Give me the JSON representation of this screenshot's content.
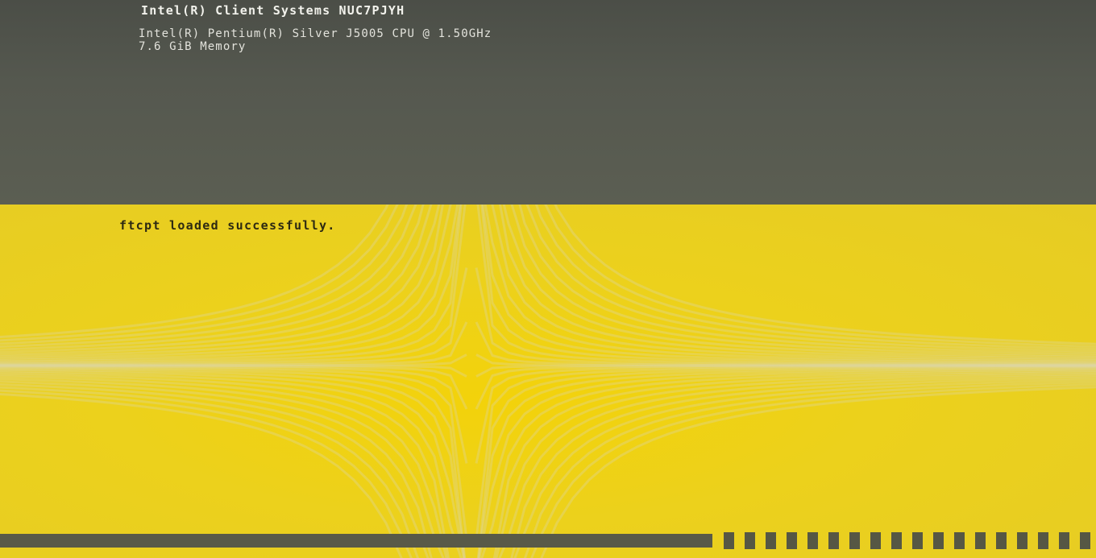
{
  "system_info": {
    "title": "Intel(R) Client Systems NUC7PJYH",
    "cpu": "Intel(R) Pentium(R) Silver J5005 CPU @ 1.50GHz",
    "memory": "7.6 GiB Memory"
  },
  "status": {
    "message": "ftcpt loaded successfully."
  },
  "progress": {
    "fraction": 0.65,
    "segments_visible": 18
  },
  "colors": {
    "top_panel": "#55584f",
    "bottom_panel": "#ecd11c",
    "progress": "#595a48"
  }
}
